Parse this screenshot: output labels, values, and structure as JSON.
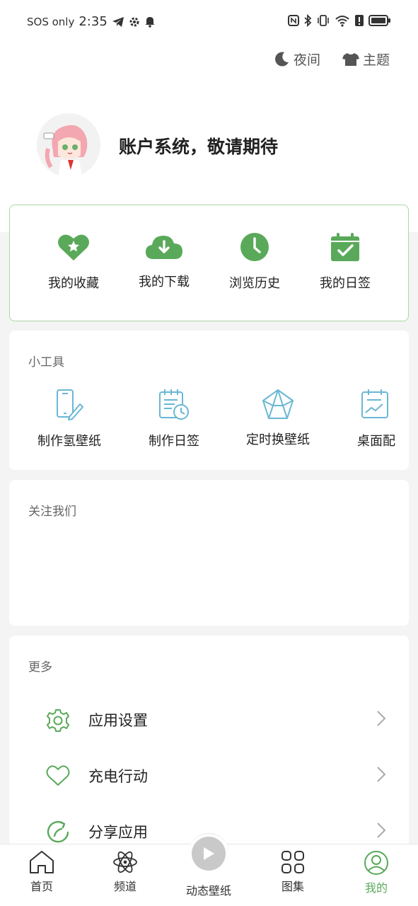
{
  "status_bar": {
    "carrier": "SOS only",
    "time": "2:35",
    "icons_left": [
      "telegram-icon",
      "gear-icon",
      "bell-icon"
    ],
    "icons_right": [
      "nfc-icon",
      "bluetooth-icon",
      "vibrate-icon",
      "wifi-icon",
      "alert-icon",
      "battery-icon"
    ]
  },
  "header": {
    "night_label": "夜间",
    "theme_label": "主题"
  },
  "profile": {
    "title": "账户系统，敬请期待"
  },
  "quick_actions": [
    {
      "label": "我的收藏",
      "icon": "heart-star-icon"
    },
    {
      "label": "我的下载",
      "icon": "cloud-download-icon"
    },
    {
      "label": "浏览历史",
      "icon": "clock-icon"
    },
    {
      "label": "我的日签",
      "icon": "calendar-check-icon"
    }
  ],
  "tools": {
    "title": "小工具",
    "items": [
      {
        "label": "制作氢壁纸",
        "icon": "phone-pen-icon"
      },
      {
        "label": "制作日签",
        "icon": "calendar-clock-icon"
      },
      {
        "label": "定时换壁纸",
        "icon": "pentagon-star-icon"
      },
      {
        "label": "桌面配",
        "icon": "calendar-chart-icon"
      }
    ]
  },
  "follow": {
    "title": "关注我们"
  },
  "more": {
    "title": "更多",
    "items": [
      {
        "label": "应用设置",
        "icon": "settings-icon"
      },
      {
        "label": "充电行动",
        "icon": "heart-outline-icon"
      },
      {
        "label": "分享应用",
        "icon": "share-refresh-icon"
      }
    ]
  },
  "bottom_nav": {
    "items": [
      {
        "label": "首页",
        "icon": "home-icon"
      },
      {
        "label": "频道",
        "icon": "atom-icon"
      },
      {
        "label": "动态壁纸",
        "icon": "play-icon"
      },
      {
        "label": "图集",
        "icon": "grid-icon"
      },
      {
        "label": "我的",
        "icon": "user-icon"
      }
    ],
    "active": "我的"
  },
  "colors": {
    "accent": "#5aa95a",
    "tool_icon": "#6ab7d4",
    "background": "#f4f4f4"
  }
}
